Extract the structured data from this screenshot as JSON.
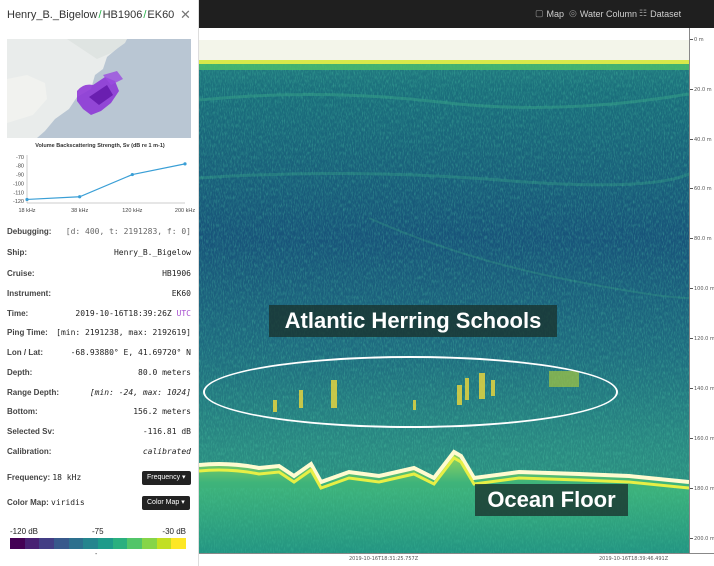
{
  "header": {
    "ship": "Henry_B._Bigelow",
    "cruise": "HB1906",
    "instrument": "EK60",
    "separator": "/",
    "close_icon": "close-icon"
  },
  "nav": {
    "map_label": "Map",
    "water_column_label": "Water Column",
    "dataset_label": "Dataset"
  },
  "spectrum_chart": {
    "title": "Volume Backscattering Strength, Sv (dB re 1 m-1)",
    "categories": [
      "18 kHz",
      "38 kHz",
      "120 kHz",
      "200 kHz"
    ],
    "values": [
      -118,
      -115,
      -90,
      -78
    ],
    "yticks": [
      "-70",
      "-80",
      "-90",
      "-100",
      "-110",
      "-120"
    ],
    "ylim": [
      -122,
      -68
    ],
    "color": "#3a9fd6"
  },
  "info": {
    "debugging_label": "Debugging:",
    "debugging_value": "[d: 400, t: 2191283, f: 0]",
    "ship_label": "Ship:",
    "ship_value": "Henry_B._Bigelow",
    "cruise_label": "Cruise:",
    "cruise_value": "HB1906",
    "instrument_label": "Instrument:",
    "instrument_value": "EK60",
    "time_label": "Time:",
    "time_value": "2019-10-16T18:39:26Z",
    "time_zone": "UTC",
    "ping_label": "Ping Time:",
    "ping_value": "[min: 2191238, max: 2192619]",
    "lonlat_label": "Lon / Lat:",
    "lonlat_value": "-68.93880° E, 41.69720° N",
    "depth_label": "Depth:",
    "depth_value": "80.0 meters",
    "range_label": "Range Depth:",
    "range_value": "[min: -24, max: 1024]",
    "bottom_label": "Bottom:",
    "bottom_value": "156.2 meters",
    "sv_label": "Selected Sv:",
    "sv_value": "-116.81 dB",
    "calibration_label": "Calibration:",
    "calibration_value": "calibrated"
  },
  "controls": {
    "frequency_label": "Frequency:",
    "frequency_value": "18 kHz",
    "frequency_button": "Frequency",
    "colormap_label": "Color Map:",
    "colormap_value": "viridis",
    "colormap_button": "Color Map"
  },
  "colorbar": {
    "min_label": "-120 dB",
    "mid_label": "-75",
    "max_label": "-30 dB",
    "marker": "-",
    "colors": [
      "#440154",
      "#482173",
      "#433e85",
      "#38598c",
      "#2d708e",
      "#25858e",
      "#1e9b8a",
      "#2ab07f",
      "#52c569",
      "#86d549",
      "#c2df23",
      "#fde725"
    ]
  },
  "echogram": {
    "annotation_schools": "Atlantic Herring Schools",
    "annotation_floor": "Ocean Floor",
    "y_ticks": [
      "0 m",
      "20.0 m",
      "40.0 m",
      "60.0 m",
      "80.0 m",
      "100.0 m",
      "120.0 m",
      "140.0 m",
      "160.0 m",
      "180.0 m",
      "200.0 m"
    ],
    "x_ticks": [
      "2019-10-16T18:31:25.757Z",
      "2019-10-16T18:39:46.491Z"
    ]
  }
}
